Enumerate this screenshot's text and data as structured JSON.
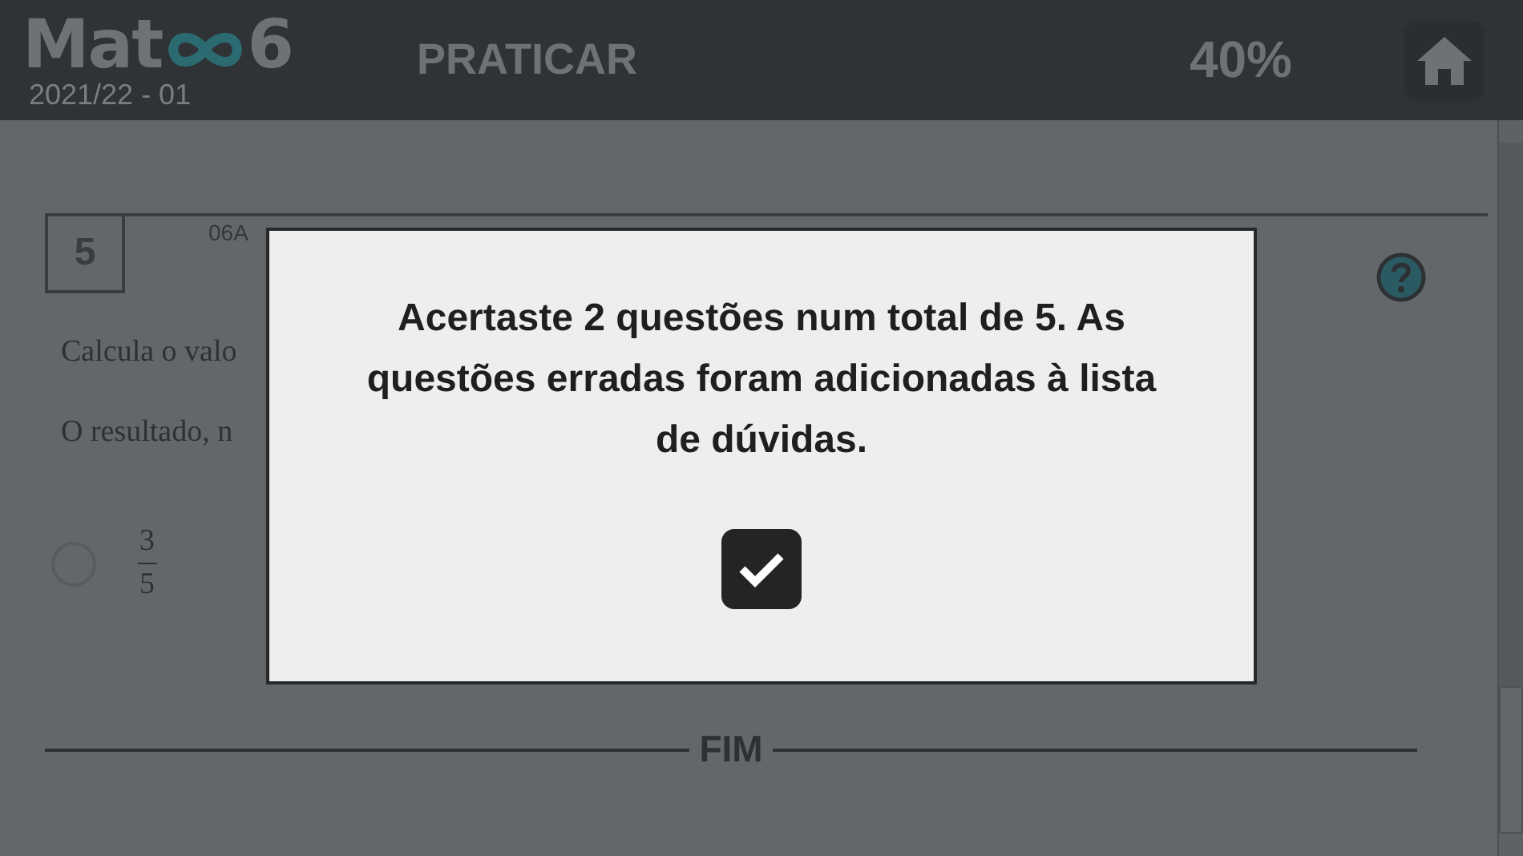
{
  "header": {
    "logo": {
      "prefix": "Mat",
      "suffix": "6"
    },
    "edition": "2021/22 - 01",
    "title": "PRATICAR",
    "progress": "40%"
  },
  "question": {
    "number": "5",
    "code": "06A",
    "lines": [
      "Calcula o valo",
      "O resultado, n"
    ],
    "options": [
      {
        "numerator": "3",
        "denominator": "5",
        "selected": false
      }
    ]
  },
  "end_label": "FIM",
  "dialog": {
    "message": "Acertaste 2 questões num total de 5. As questões erradas foram adicionadas à lista de dúvidas."
  }
}
